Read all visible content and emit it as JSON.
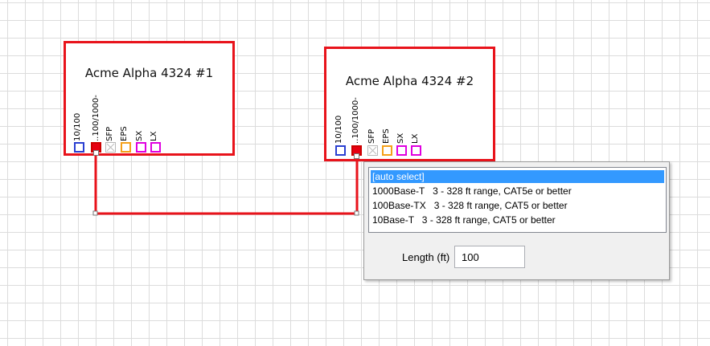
{
  "devices": [
    {
      "name": "Acme Alpha 4324 #1",
      "ports": [
        {
          "label": "10/100",
          "color": "#2a3fd1"
        },
        {
          "label": "..100/1000-",
          "color": "#cc0000",
          "selected": true
        },
        {
          "label": "SFP",
          "color": "#b8b8b8"
        },
        {
          "label": "EPS",
          "color": "#f5a019"
        },
        {
          "label": "SX",
          "color": "#e000e0"
        },
        {
          "label": "LX",
          "color": "#e000e0"
        }
      ]
    },
    {
      "name": "Acme Alpha 4324 #2",
      "ports": [
        {
          "label": "10/100",
          "color": "#2a3fd1"
        },
        {
          "label": "..100/1000-",
          "color": "#cc0000",
          "selected": true
        },
        {
          "label": "SFP",
          "color": "#b8b8b8"
        },
        {
          "label": "EPS",
          "color": "#f5a019"
        },
        {
          "label": "SX",
          "color": "#e000e0"
        },
        {
          "label": "LX",
          "color": "#e000e0"
        }
      ]
    }
  ],
  "link_color": "#e8131b",
  "cable_popup": {
    "options": [
      "[auto select]",
      "1000Base-T   3 - 328 ft range, CAT5e or better",
      "100Base-TX   3 - 328 ft range, CAT5 or better",
      "10Base-T   3 - 328 ft range, CAT5 or better"
    ],
    "selected_index": 0,
    "length_label": "Length (ft)",
    "length_value": "100"
  }
}
